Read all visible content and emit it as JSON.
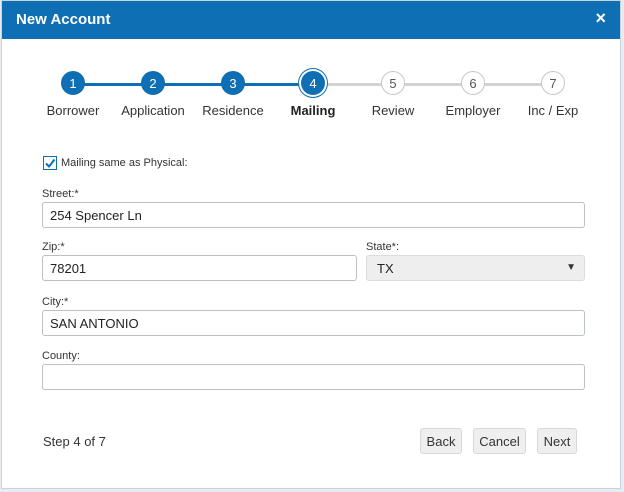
{
  "dialog": {
    "title": "New Account",
    "close_symbol": "×"
  },
  "stepper": {
    "steps": [
      {
        "number": "1",
        "label": "Borrower",
        "state": "done"
      },
      {
        "number": "2",
        "label": "Application",
        "state": "done"
      },
      {
        "number": "3",
        "label": "Residence",
        "state": "done"
      },
      {
        "number": "4",
        "label": "Mailing",
        "state": "current"
      },
      {
        "number": "5",
        "label": "Review",
        "state": "todo"
      },
      {
        "number": "6",
        "label": "Employer",
        "state": "todo"
      },
      {
        "number": "7",
        "label": "Inc / Exp",
        "state": "todo"
      }
    ]
  },
  "form": {
    "mailing_same": {
      "label": "Mailing same as Physical:",
      "checked": true
    },
    "street": {
      "label": "Street:*",
      "value": "254 Spencer Ln"
    },
    "zip": {
      "label": "Zip:*",
      "value": "78201"
    },
    "state": {
      "label": "State*:",
      "value": "TX"
    },
    "city": {
      "label": "City:*",
      "value": "SAN ANTONIO"
    },
    "county": {
      "label": "County:",
      "value": ""
    }
  },
  "footer": {
    "step_text": "Step 4 of 7",
    "back_label": "Back",
    "cancel_label": "Cancel",
    "next_label": "Next"
  },
  "colors": {
    "primary": "#0f6fb4",
    "line_todo": "#d3d3d3"
  }
}
